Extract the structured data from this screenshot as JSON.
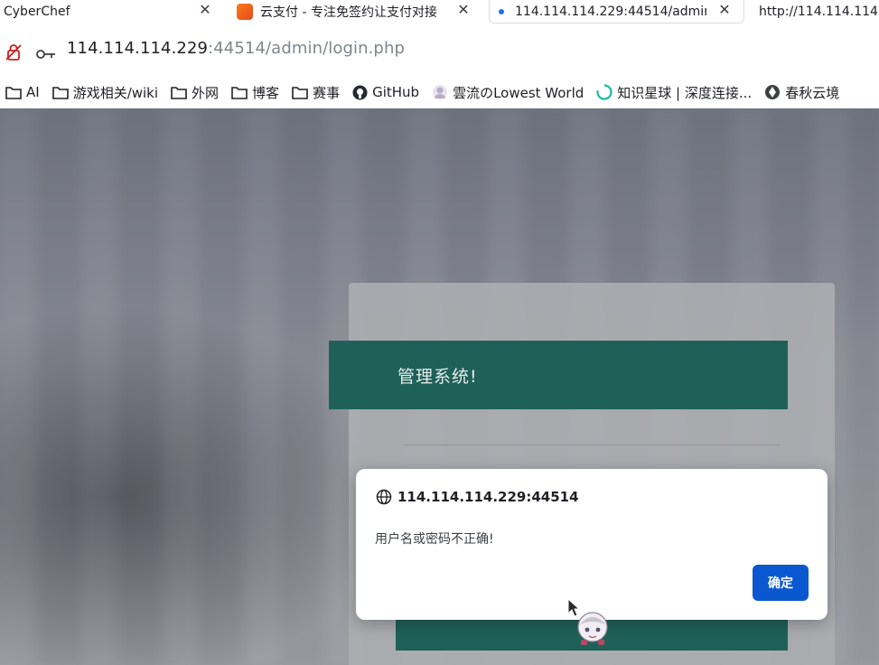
{
  "tabs": [
    {
      "title": "CyberChef",
      "close": "✕"
    },
    {
      "title": "云支付 - 专注免签约让支付对接",
      "close": "✕"
    },
    {
      "title": "114.114.114.229:44514/admin",
      "close": "✕",
      "active": true
    },
    {
      "title": "http://114.114.114"
    }
  ],
  "address": {
    "host": "114.114.114.229",
    "port_path": ":44514/admin/login.php"
  },
  "bookmarks": [
    {
      "label": "AI",
      "icon": "folder-icon"
    },
    {
      "label": "游戏相关/wiki",
      "icon": "folder-icon"
    },
    {
      "label": "外网",
      "icon": "folder-icon"
    },
    {
      "label": "博客",
      "icon": "folder-icon"
    },
    {
      "label": "赛事",
      "icon": "folder-icon"
    },
    {
      "label": "GitHub",
      "icon": "github-icon"
    },
    {
      "label": "雲流のLowest World",
      "icon": "avatar-icon"
    },
    {
      "label": "知识星球 | 深度连接...",
      "icon": "loading-ring-icon"
    },
    {
      "label": "春秋云境",
      "icon": "site-icon"
    }
  ],
  "login": {
    "title": "管理系统!"
  },
  "dialog": {
    "origin": "114.114.114.229:44514",
    "message": "用户名或密码不正确!",
    "ok_label": "确定"
  },
  "colors": {
    "accent": "#1f6158",
    "dialog_button": "#0b57d0"
  }
}
